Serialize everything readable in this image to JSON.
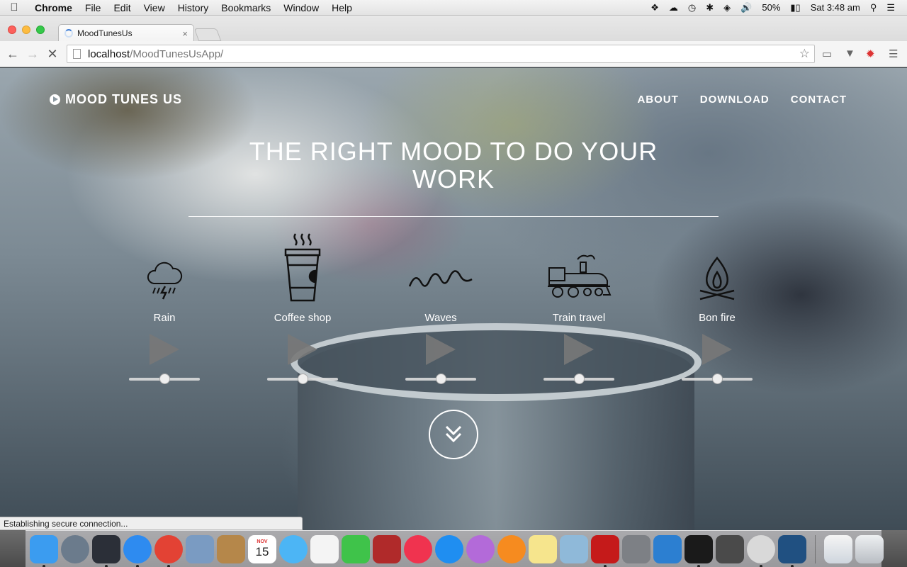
{
  "menubar": {
    "app_name": "Chrome",
    "items": [
      "File",
      "Edit",
      "View",
      "History",
      "Bookmarks",
      "Window",
      "Help"
    ],
    "battery": "50%",
    "clock": "Sat 3:48 am"
  },
  "browser": {
    "tab_title": "MoodTunesUs",
    "tab_close": "×",
    "url_host": "localhost",
    "url_path": "/MoodTunesUsApp/",
    "status_text": "Establishing secure connection..."
  },
  "site": {
    "logo_text": "MOOD TUNES US",
    "nav": [
      "ABOUT",
      "DOWNLOAD",
      "CONTACT"
    ],
    "headline_line1": "THE RIGHT MOOD TO DO YOUR",
    "headline_line2": "WORK",
    "sounds": [
      {
        "label": "Rain",
        "icon": "rain-cloud-icon",
        "volume": 0.5
      },
      {
        "label": "Coffee shop",
        "icon": "coffee-cup-icon",
        "volume": 0.5
      },
      {
        "label": "Waves",
        "icon": "waves-icon",
        "volume": 0.5
      },
      {
        "label": "Train travel",
        "icon": "train-icon",
        "volume": 0.5
      },
      {
        "label": "Bon fire",
        "icon": "bonfire-icon",
        "volume": 0.5
      }
    ]
  },
  "dock": {
    "calendar_month": "NOV",
    "calendar_day": "15",
    "apps": [
      {
        "name": "finder",
        "color": "#3b9cf0",
        "running": true
      },
      {
        "name": "launchpad",
        "color": "#6b7b8c",
        "running": false
      },
      {
        "name": "mission-control",
        "color": "#2b2f38",
        "running": true
      },
      {
        "name": "safari",
        "color": "#2e8bf0",
        "running": true
      },
      {
        "name": "chrome",
        "color": "#e34234",
        "running": true
      },
      {
        "name": "mail-eagle",
        "color": "#7a9bc2",
        "running": false
      },
      {
        "name": "contacts",
        "color": "#b5874a",
        "running": false
      },
      {
        "name": "calendar",
        "color": "#ffffff",
        "running": false
      },
      {
        "name": "messages",
        "color": "#4cb5f5",
        "running": false
      },
      {
        "name": "reminders",
        "color": "#f4f4f4",
        "running": false
      },
      {
        "name": "facetime",
        "color": "#3fc34a",
        "running": false
      },
      {
        "name": "photo-booth",
        "color": "#b02a2a",
        "running": false
      },
      {
        "name": "itunes",
        "color": "#f0334f",
        "running": false
      },
      {
        "name": "app-store",
        "color": "#1f8ef1",
        "running": false
      },
      {
        "name": "feedback",
        "color": "#b36ad9",
        "running": false
      },
      {
        "name": "ibooks",
        "color": "#f68b1f",
        "running": false
      },
      {
        "name": "notes",
        "color": "#f6e58d",
        "running": false
      },
      {
        "name": "preview",
        "color": "#8fb9d9",
        "running": false
      },
      {
        "name": "acrobat",
        "color": "#c51a1a",
        "running": true
      },
      {
        "name": "system-preferences",
        "color": "#7d8085",
        "running": false
      },
      {
        "name": "xcode",
        "color": "#2c7fd1",
        "running": false
      },
      {
        "name": "terminal",
        "color": "#1a1a1a",
        "running": true
      },
      {
        "name": "sublime-text",
        "color": "#4a4a4a",
        "running": false
      },
      {
        "name": "sequel",
        "color": "#d9d9d9",
        "running": true
      },
      {
        "name": "sourcetree",
        "color": "#205081",
        "running": true
      }
    ]
  }
}
